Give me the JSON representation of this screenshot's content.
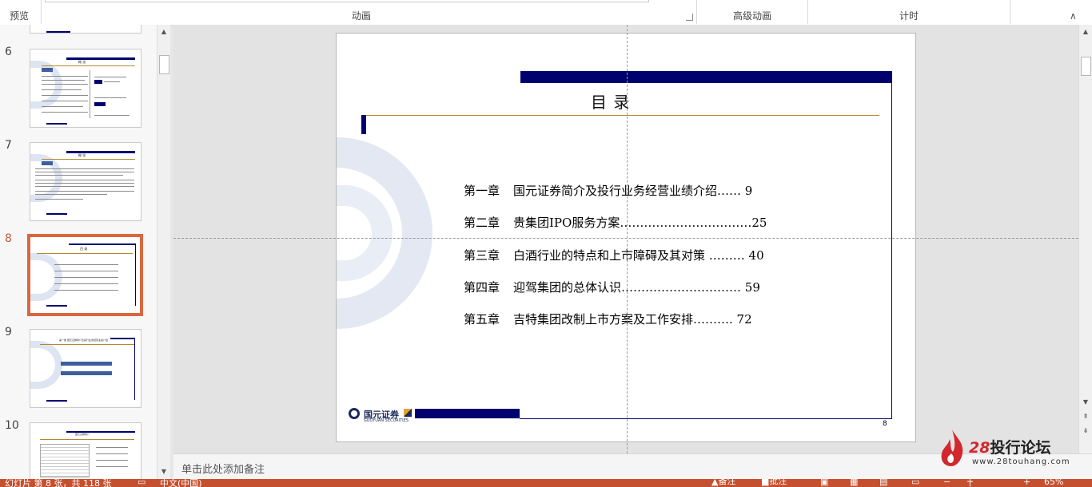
{
  "ribbon": {
    "preview_label": "预览",
    "animation_group": "动画",
    "advanced_animation_group": "高级动画",
    "timing_group": "计时"
  },
  "thumbnails": [
    {
      "number": "6",
      "title": "概 览",
      "type": "two-column"
    },
    {
      "number": "7",
      "title": "概 览",
      "type": "text"
    },
    {
      "number": "8",
      "title": "目 录",
      "type": "toc",
      "selected": true
    },
    {
      "number": "9",
      "title": "第一章  国元证券简介及投行业务经营业绩介绍",
      "type": "chapter"
    },
    {
      "number": "10",
      "title": "国元证券简介",
      "type": "table"
    }
  ],
  "slide": {
    "title": "目     录",
    "toc": [
      {
        "chapter": "第一章",
        "text": "国元证券简介及投行业务经营业绩介绍……  9"
      },
      {
        "chapter": "第二章",
        "text": "贵集团IPO服务方案……………………………25"
      },
      {
        "chapter": "第三章",
        "text": "白酒行业的特点和上市障碍及其对策 ……… 40"
      },
      {
        "chapter": "第四章",
        "text": "迎驾集团的总体认识………………………… 59"
      },
      {
        "chapter": "第五章",
        "text": "吉特集团改制上市方案及工作安排……….  72"
      }
    ],
    "page_number": "8",
    "logo_text": "国元证券",
    "logo_sub": "GUOYUAN SECURITIES"
  },
  "notes": {
    "placeholder": "单击此处添加备注"
  },
  "status": {
    "slide_info": "幻灯片 第 8 张，共 118 张",
    "language": "中文(中国)",
    "notes_btn": "备注",
    "comments_btn": "批注",
    "zoom": "65%"
  },
  "watermark": {
    "title_num": "28",
    "title_text": "投行论坛",
    "url": "www.28touhang.com"
  },
  "colors": {
    "accent": "#d9673f",
    "slide_bar": "#00006e",
    "gold_line": "#b08a2c",
    "status_bar": "#c5502f"
  }
}
